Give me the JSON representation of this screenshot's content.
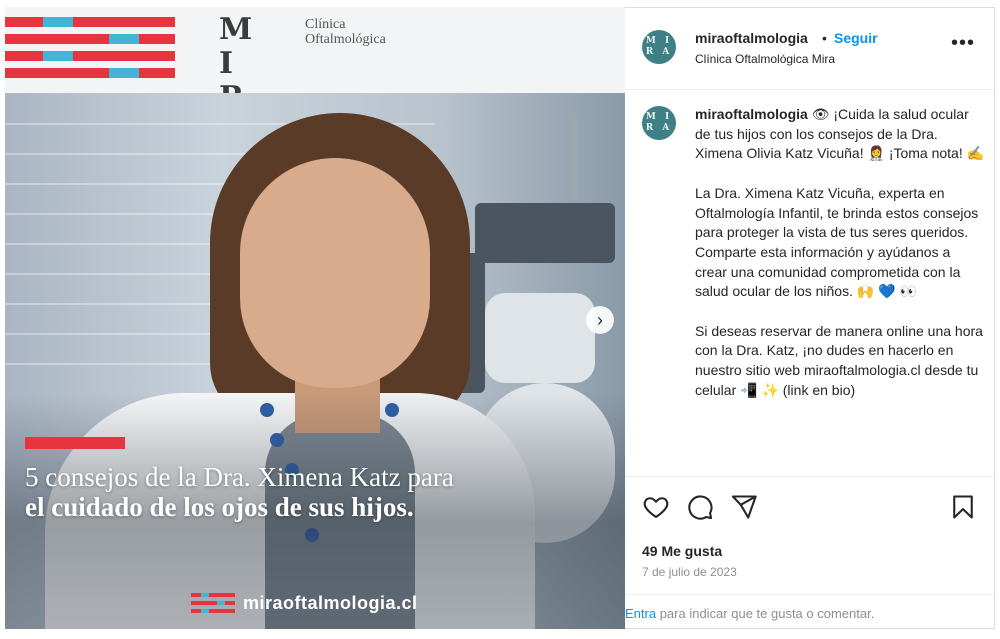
{
  "image": {
    "logo_letters_top": "M I",
    "logo_letters_bottom": "R A",
    "logo_sub_line1": "Clínica",
    "logo_sub_line2": "Oftalmológica",
    "headline_line1": "5 consejos de la Dra. Ximena Katz para",
    "headline_line2": "el cuidado de los ojos de sus hijos.",
    "footer_url": "miraoftalmologia.cl",
    "next_glyph": "›",
    "colors": {
      "red": "#e6353f",
      "blue": "#43b3d6"
    }
  },
  "header": {
    "avatar_text": "M I\nR A",
    "username": "miraoftalmologia",
    "dot": "•",
    "follow_label": "Seguir",
    "subtitle": "Clínica Oftalmológica Mira",
    "more_icon": "•••"
  },
  "caption": {
    "username": "miraoftalmologia",
    "p1": " 👁 ¡Cuida la salud ocular de tus hijos con los consejos de la Dra. Ximena Olivia Katz Vicuña! 👩‍⚕️ ¡Toma nota! ✍️",
    "p2": "La Dra. Ximena Katz Vicuña, experta en Oftalmología Infantil, te brinda estos consejos para proteger la vista de tus seres queridos. Comparte esta información y ayúdanos a crear una comunidad comprometida con la salud ocular de los niños. 🙌 💙 👀",
    "p3": "Si deseas reservar de manera online una hora con la Dra. Katz, ¡no dudes en hacerlo en nuestro sitio web miraoftalmologia.cl desde tu celular 📲 ✨ (link en bio)"
  },
  "actions": {
    "icons": [
      "heart-icon",
      "comment-icon",
      "share-icon",
      "bookmark-icon"
    ],
    "likes": "49 Me gusta",
    "date": "7 de julio de 2023",
    "comment_link": "Entra",
    "comment_rest": " para indicar que te gusta o comentar."
  }
}
